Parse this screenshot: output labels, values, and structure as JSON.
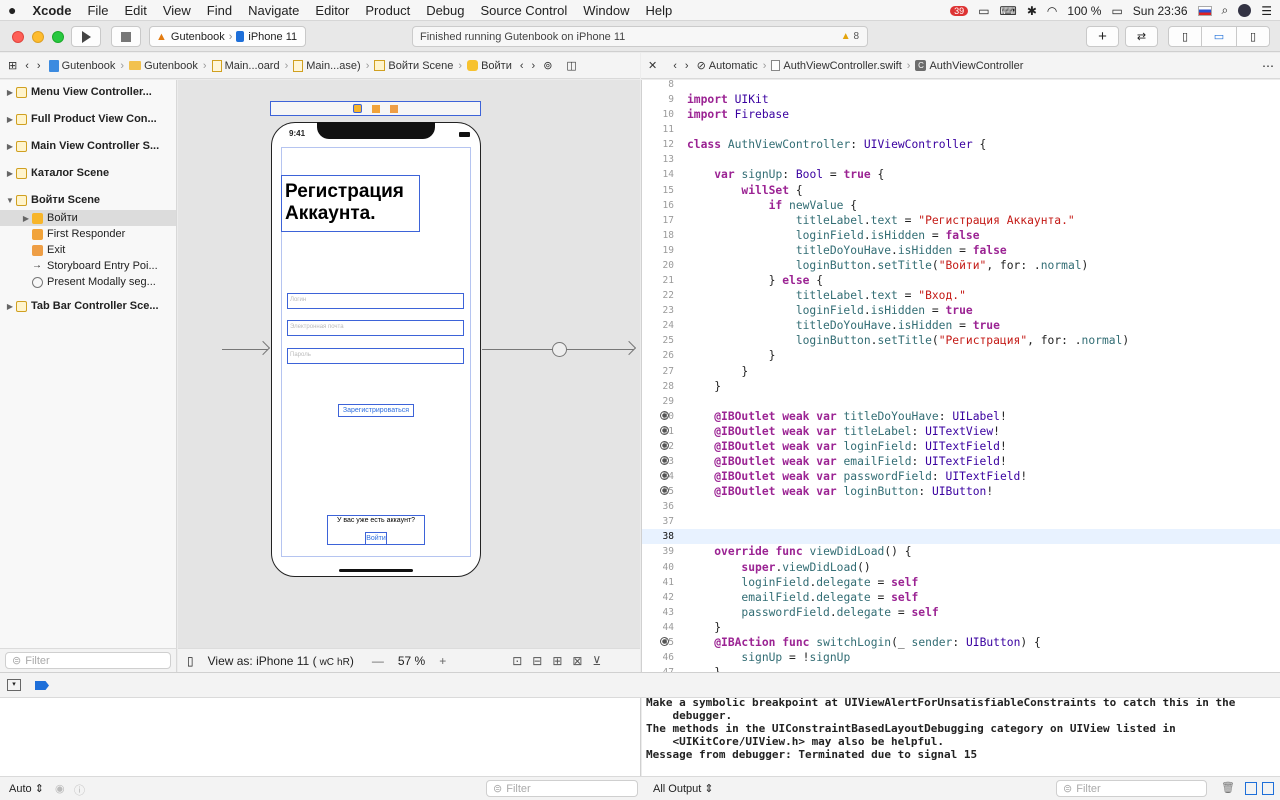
{
  "menubar": {
    "apple": "",
    "app": "Xcode",
    "items": [
      "File",
      "Edit",
      "View",
      "Find",
      "Navigate",
      "Editor",
      "Product",
      "Debug",
      "Source Control",
      "Window",
      "Help"
    ],
    "badge": "39",
    "battery": "100 %",
    "clock": "Sun 23:36"
  },
  "toolbar": {
    "scheme": "Gutenbook",
    "device": "iPhone 11",
    "status": "Finished running Gutenbook on iPhone 11",
    "warnings": "8"
  },
  "jumpbar_left": [
    "Gutenbook",
    "Gutenbook",
    "Main...oard",
    "Main...ase)",
    "Войти Scene",
    "Войти"
  ],
  "jumpbar_right": [
    "Automatic",
    "AuthViewController.swift",
    "AuthViewController"
  ],
  "outline": {
    "items": [
      {
        "label": "Menu View Controller...",
        "level": 0,
        "bold": true
      },
      {
        "label": "Full Product View Con...",
        "level": 0,
        "bold": true
      },
      {
        "label": "Main View Controller S...",
        "level": 0,
        "bold": true
      },
      {
        "label": "Каталог Scene",
        "level": 0,
        "bold": true
      },
      {
        "label": "Войти Scene",
        "level": 0,
        "bold": true,
        "open": true
      },
      {
        "label": "Войти",
        "level": 1,
        "bold": false,
        "selected": true
      },
      {
        "label": "First Responder",
        "level": 1,
        "bold": false
      },
      {
        "label": "Exit",
        "level": 1,
        "bold": false
      },
      {
        "label": "Storyboard Entry Poi...",
        "level": 1,
        "bold": false
      },
      {
        "label": "Present Modally seg...",
        "level": 1,
        "bold": false
      },
      {
        "label": "Tab Bar Controller Sce...",
        "level": 0,
        "bold": true
      }
    ],
    "filter_placeholder": "Filter"
  },
  "device_preview": {
    "time": "9:41",
    "title": "Регистрация Аккаунта.",
    "field_name": "Логин",
    "field_email": "Электронная почта",
    "field_password": "Пароль",
    "register_button": "Зарегистрироваться",
    "have_account": "У вас уже есть аккаунт?",
    "login_button": "Войти"
  },
  "canvasbar": {
    "view_as": "View as: iPhone 11 (",
    "wc": "wC",
    "hr": "hR",
    "close": ")",
    "minus": "—",
    "zoom": "57 %",
    "plus": "+"
  },
  "code_lines": [
    {
      "n": "8",
      "t": ""
    },
    {
      "n": "9",
      "t": "import UIKit"
    },
    {
      "n": "10",
      "t": "import Firebase"
    },
    {
      "n": "11",
      "t": ""
    },
    {
      "n": "12",
      "t": "class AuthViewController: UIViewController {"
    },
    {
      "n": "13",
      "t": ""
    },
    {
      "n": "14",
      "t": "    var signUp: Bool = true {"
    },
    {
      "n": "15",
      "t": "        willSet {"
    },
    {
      "n": "16",
      "t": "            if newValue {"
    },
    {
      "n": "17",
      "t": "                titleLabel.text = \"Регистрация Аккаунта.\""
    },
    {
      "n": "18",
      "t": "                loginField.isHidden = false"
    },
    {
      "n": "19",
      "t": "                titleDoYouHave.isHidden = false"
    },
    {
      "n": "20",
      "t": "                loginButton.setTitle(\"Войти\", for: .normal)"
    },
    {
      "n": "21",
      "t": "            } else {"
    },
    {
      "n": "22",
      "t": "                titleLabel.text = \"Вход.\""
    },
    {
      "n": "23",
      "t": "                loginField.isHidden = true"
    },
    {
      "n": "24",
      "t": "                titleDoYouHave.isHidden = true"
    },
    {
      "n": "25",
      "t": "                loginButton.setTitle(\"Регистрация\", for: .normal)"
    },
    {
      "n": "26",
      "t": "            }"
    },
    {
      "n": "27",
      "t": "        }"
    },
    {
      "n": "28",
      "t": "    }"
    },
    {
      "n": "29",
      "t": ""
    },
    {
      "n": "30",
      "t": "    @IBOutlet weak var titleDoYouHave: UILabel!",
      "outlet": true
    },
    {
      "n": "31",
      "t": "    @IBOutlet weak var titleLabel: UITextView!",
      "outlet": true
    },
    {
      "n": "32",
      "t": "    @IBOutlet weak var loginField: UITextField!",
      "outlet": true
    },
    {
      "n": "33",
      "t": "    @IBOutlet weak var emailField: UITextField!",
      "outlet": true
    },
    {
      "n": "34",
      "t": "    @IBOutlet weak var passwordField: UITextField!",
      "outlet": true
    },
    {
      "n": "35",
      "t": "    @IBOutlet weak var loginButton: UIButton!",
      "outlet": true
    },
    {
      "n": "36",
      "t": ""
    },
    {
      "n": "37",
      "t": ""
    },
    {
      "n": "38",
      "t": "",
      "current": true
    },
    {
      "n": "39",
      "t": "    override func viewDidLoad() {"
    },
    {
      "n": "40",
      "t": "        super.viewDidLoad()"
    },
    {
      "n": "41",
      "t": "        loginField.delegate = self"
    },
    {
      "n": "42",
      "t": "        emailField.delegate = self"
    },
    {
      "n": "43",
      "t": "        passwordField.delegate = self"
    },
    {
      "n": "44",
      "t": "    }"
    },
    {
      "n": "45",
      "t": "    @IBAction func switchLogin(_ sender: UIButton) {",
      "outlet": true
    },
    {
      "n": "46",
      "t": "        signUp = !signUp"
    },
    {
      "n": "47",
      "t": "    }"
    }
  ],
  "console": {
    "lines": [
      "Make a symbolic breakpoint at UIViewAlertForUnsatisfiableConstraints to catch this in the",
      "    debugger.",
      "The methods in the UIConstraintBasedLayoutDebugging category on UIView listed in",
      "    <UIKitCore/UIView.h> may also be helpful.",
      "Message from debugger: Terminated due to signal 15"
    ]
  },
  "bottombar": {
    "auto": "Auto",
    "filter": "Filter",
    "output": "All Output",
    "filter2": "Filter"
  }
}
